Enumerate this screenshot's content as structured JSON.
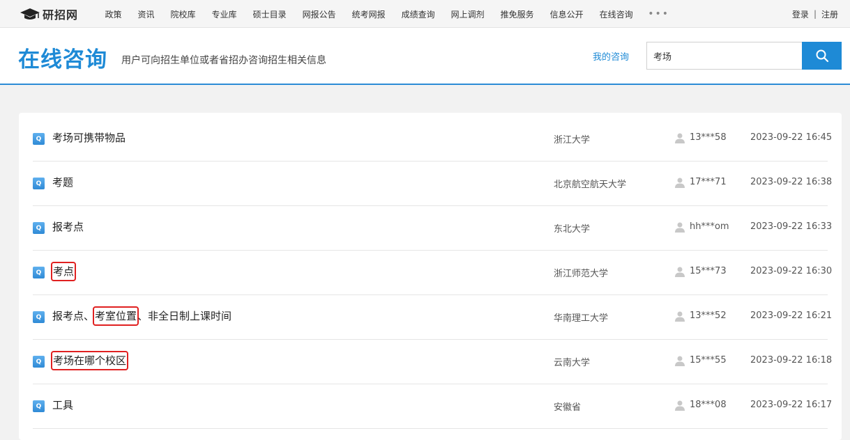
{
  "site": {
    "logo_text": "研招网"
  },
  "nav": {
    "items": [
      "政策",
      "资讯",
      "院校库",
      "专业库",
      "硕士目录",
      "网报公告",
      "统考网报",
      "成绩查询",
      "网上调剂",
      "推免服务",
      "信息公开",
      "在线咨询"
    ],
    "more": "•••"
  },
  "auth": {
    "login": "登录",
    "separator": "|",
    "register": "注册"
  },
  "header": {
    "title": "在线咨询",
    "subtitle": "用户可向招生单位或者省招办咨询招生相关信息",
    "my_link": "我的咨询"
  },
  "search": {
    "value": "考场"
  },
  "q_label": "Q",
  "questions": [
    {
      "parts": [
        "考场可携带物品"
      ],
      "school": "浙江大学",
      "user": "13***58",
      "time": "2023-09-22 16:45"
    },
    {
      "parts": [
        "考题"
      ],
      "school": "北京航空航天大学",
      "user": "17***71",
      "time": "2023-09-22 16:38"
    },
    {
      "parts": [
        "报考点"
      ],
      "school": "东北大学",
      "user": "hh***om",
      "time": "2023-09-22 16:33"
    },
    {
      "parts": [
        "考点"
      ],
      "school": "浙江师范大学",
      "user": "15***73",
      "time": "2023-09-22 16:30"
    },
    {
      "parts": [
        "报考点、",
        "考室位置",
        "、非全日制上课时间"
      ],
      "school": "华南理工大学",
      "user": "13***52",
      "time": "2023-09-22 16:21"
    },
    {
      "parts": [
        "考场在哪个校区"
      ],
      "school": "云南大学",
      "user": "15***55",
      "time": "2023-09-22 16:18"
    },
    {
      "parts": [
        "工具"
      ],
      "school": "安徽省",
      "user": "18***08",
      "time": "2023-09-22 16:17"
    }
  ],
  "colors": {
    "accent": "#1e8ad6",
    "highlight_box": "#e02020"
  },
  "icons": {
    "logo": "graduation-cap-icon",
    "search": "search-icon",
    "question": "q-icon",
    "user": "user-icon"
  }
}
